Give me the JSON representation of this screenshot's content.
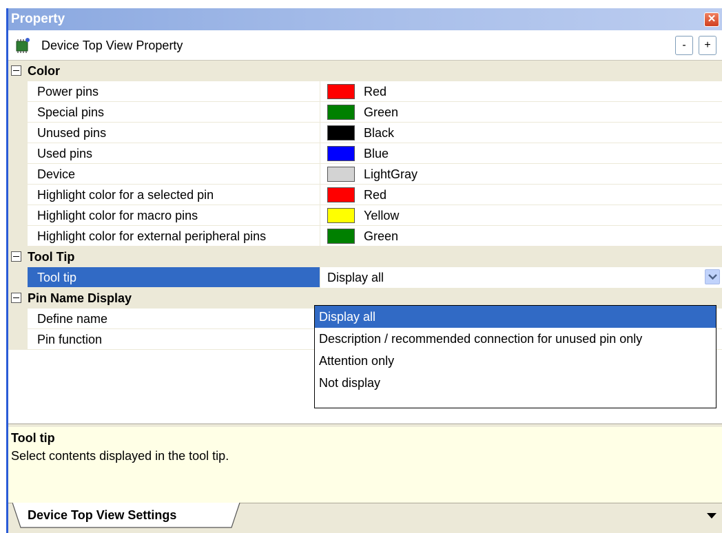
{
  "window": {
    "title": "Property"
  },
  "header": {
    "title": "Device Top View Property",
    "icon": "chip-icon",
    "collapse_label": "-",
    "expand_label": "+"
  },
  "categories": {
    "color": {
      "label": "Color",
      "items": [
        {
          "name": "Power pins",
          "value": "Red",
          "swatch": "#ff0000"
        },
        {
          "name": "Special pins",
          "value": "Green",
          "swatch": "#008000"
        },
        {
          "name": "Unused pins",
          "value": "Black",
          "swatch": "#000000"
        },
        {
          "name": "Used pins",
          "value": "Blue",
          "swatch": "#0000ff"
        },
        {
          "name": "Device",
          "value": "LightGray",
          "swatch": "#d3d3d3"
        },
        {
          "name": "Highlight color for a selected pin",
          "value": "Red",
          "swatch": "#ff0000"
        },
        {
          "name": "Highlight color for macro pins",
          "value": "Yellow",
          "swatch": "#ffff00"
        },
        {
          "name": "Highlight color for external peripheral pins",
          "value": "Green",
          "swatch": "#008000"
        }
      ]
    },
    "tooltip": {
      "label": "Tool Tip",
      "item": {
        "name": "Tool tip",
        "value": "Display all"
      }
    },
    "pin_name": {
      "label": "Pin Name Display",
      "items": [
        {
          "name": "Define name"
        },
        {
          "name": "Pin function"
        }
      ]
    }
  },
  "dropdown": {
    "options": [
      "Display all",
      "Description / recommended connection for unused pin only",
      "Attention only",
      "Not display"
    ],
    "selected_index": 0
  },
  "description": {
    "title": "Tool tip",
    "text": "Select contents displayed in the tool tip."
  },
  "tabs": [
    {
      "label": "Device Top View Settings",
      "active": true
    }
  ],
  "colors": {
    "selection": "#316ac5",
    "category_bg": "#ece9d8",
    "desc_bg": "#ffffe6"
  }
}
